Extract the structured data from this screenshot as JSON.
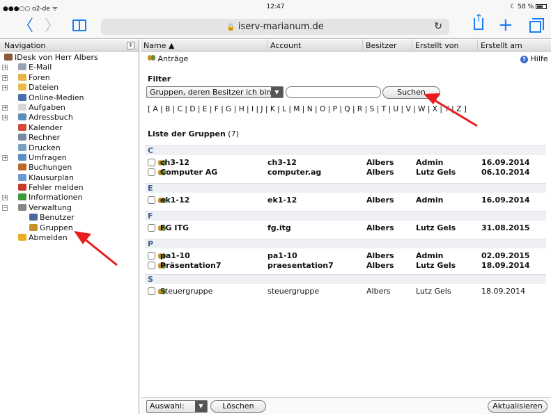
{
  "status": {
    "carrier": "●●●○○ o2-de ᯤ",
    "time": "12:47",
    "battery": "☾ 58 %"
  },
  "browser": {
    "address": "iserv-marianum.de",
    "lock": "🔒",
    "back": "〈",
    "forward": "〉",
    "reload": "↻",
    "add": "+"
  },
  "sidebar": {
    "title": "Navigation",
    "items": [
      {
        "label": "IDesk von Herr Albers",
        "color": "#8a5a3c"
      },
      {
        "label": "E-Mail",
        "color": "#9aa6b8",
        "expand": "+"
      },
      {
        "label": "Foren",
        "color": "#e8b34a",
        "expand": "+"
      },
      {
        "label": "Dateien",
        "color": "#e9b949",
        "expand": "+"
      },
      {
        "label": "Online-Medien",
        "color": "#4a6fa8"
      },
      {
        "label": "Aufgaben",
        "color": "#d8d8d8",
        "expand": "+"
      },
      {
        "label": "Adressbuch",
        "color": "#5a8fb5",
        "expand": "+"
      },
      {
        "label": "Kalender",
        "color": "#d24a3a"
      },
      {
        "label": "Rechner",
        "color": "#7a8aa0"
      },
      {
        "label": "Drucken",
        "color": "#7aa0c0"
      },
      {
        "label": "Umfragen",
        "color": "#5a90c8",
        "expand": "+"
      },
      {
        "label": "Buchungen",
        "color": "#b86a2a"
      },
      {
        "label": "Klausurplan",
        "color": "#6a9ad0"
      },
      {
        "label": "Fehler melden",
        "color": "#c83a2a"
      },
      {
        "label": "Informationen",
        "color": "#3a9a3a",
        "expand": "+"
      },
      {
        "label": "Verwaltung",
        "color": "#888888",
        "expand": "−"
      },
      {
        "label": "Benutzer",
        "color": "#4a6a9a",
        "indent": true
      },
      {
        "label": "Gruppen",
        "color": "#c6902b",
        "indent": true
      },
      {
        "label": "Abmelden",
        "color": "#e8b020"
      }
    ]
  },
  "main": {
    "columns": {
      "name": "Name ▲",
      "account": "Account",
      "owner": "Besitzer",
      "created_by": "Erstellt von",
      "created_at": "Erstellt am"
    },
    "requests": "Anträge",
    "help": "Hilfe",
    "filter_title": "Filter",
    "filter_select": "Gruppen, deren Besitzer ich bin",
    "search_button": "Suchen",
    "alphabet": "[ A | B | C | D | E | F | G | H | I | J | K | L | M | N | O | P | Q | R | S | T | U | V | W | X | Y | Z ]",
    "list_title": "Liste der Gruppen",
    "list_count": "(7)",
    "sections": [
      {
        "letter": "C",
        "rows": [
          {
            "name": "ch3-12",
            "account": "ch3-12",
            "owner": "Albers",
            "created_by": "Admin",
            "created_at": "16.09.2014",
            "bold": true
          },
          {
            "name": "Computer AG",
            "account": "computer.ag",
            "owner": "Albers",
            "created_by": "Lutz Gels",
            "created_at": "06.10.2014",
            "bold": true
          }
        ]
      },
      {
        "letter": "E",
        "rows": [
          {
            "name": "ek1-12",
            "account": "ek1-12",
            "owner": "Albers",
            "created_by": "Admin",
            "created_at": "16.09.2014",
            "bold": true
          }
        ]
      },
      {
        "letter": "F",
        "rows": [
          {
            "name": "FG ITG",
            "account": "fg.itg",
            "owner": "Albers",
            "created_by": "Lutz Gels",
            "created_at": "31.08.2015",
            "bold": true
          }
        ]
      },
      {
        "letter": "P",
        "rows": [
          {
            "name": "pa1-10",
            "account": "pa1-10",
            "owner": "Albers",
            "created_by": "Admin",
            "created_at": "02.09.2015",
            "bold": true
          },
          {
            "name": "Präsentation7",
            "account": "praesentation7",
            "owner": "Albers",
            "created_by": "Lutz Gels",
            "created_at": "18.09.2014",
            "bold": true
          }
        ]
      },
      {
        "letter": "S",
        "rows": [
          {
            "name": "Steuergruppe",
            "account": "steuergruppe",
            "owner": "Albers",
            "created_by": "Lutz Gels",
            "created_at": "18.09.2014",
            "bold": false
          }
        ]
      }
    ],
    "bottom": {
      "selection": "Auswahl:",
      "delete": "Löschen",
      "refresh": "Aktualisieren"
    }
  }
}
